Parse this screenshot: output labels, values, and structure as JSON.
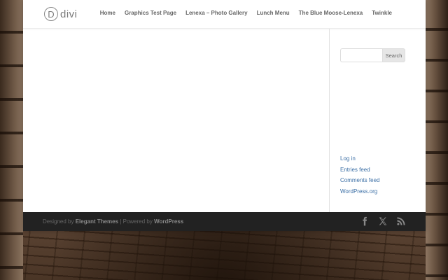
{
  "logo": {
    "mark": "D",
    "text": "divi"
  },
  "nav": {
    "items": [
      {
        "label": "Home"
      },
      {
        "label": "Graphics Test Page"
      },
      {
        "label": "Lenexa – Photo Gallery"
      },
      {
        "label": "Lunch Menu"
      },
      {
        "label": "The Blue Moose-Lenexa"
      },
      {
        "label": "Twinkle"
      }
    ]
  },
  "sidebar": {
    "search": {
      "value": "",
      "placeholder": "",
      "button_label": "Search"
    },
    "meta_links": [
      {
        "label": "Log in"
      },
      {
        "label": "Entries feed"
      },
      {
        "label": "Comments feed"
      },
      {
        "label": "WordPress.org"
      }
    ]
  },
  "footer": {
    "designed_by": "Designed by",
    "theme_name": "Elegant Themes",
    "separator": "| Powered by",
    "platform": "WordPress",
    "social_icons": [
      "facebook-icon",
      "x-twitter-icon",
      "rss-icon"
    ]
  },
  "colors": {
    "link": "#3a6ea5",
    "nav_text": "#666666",
    "footer_bg": "#222222"
  }
}
